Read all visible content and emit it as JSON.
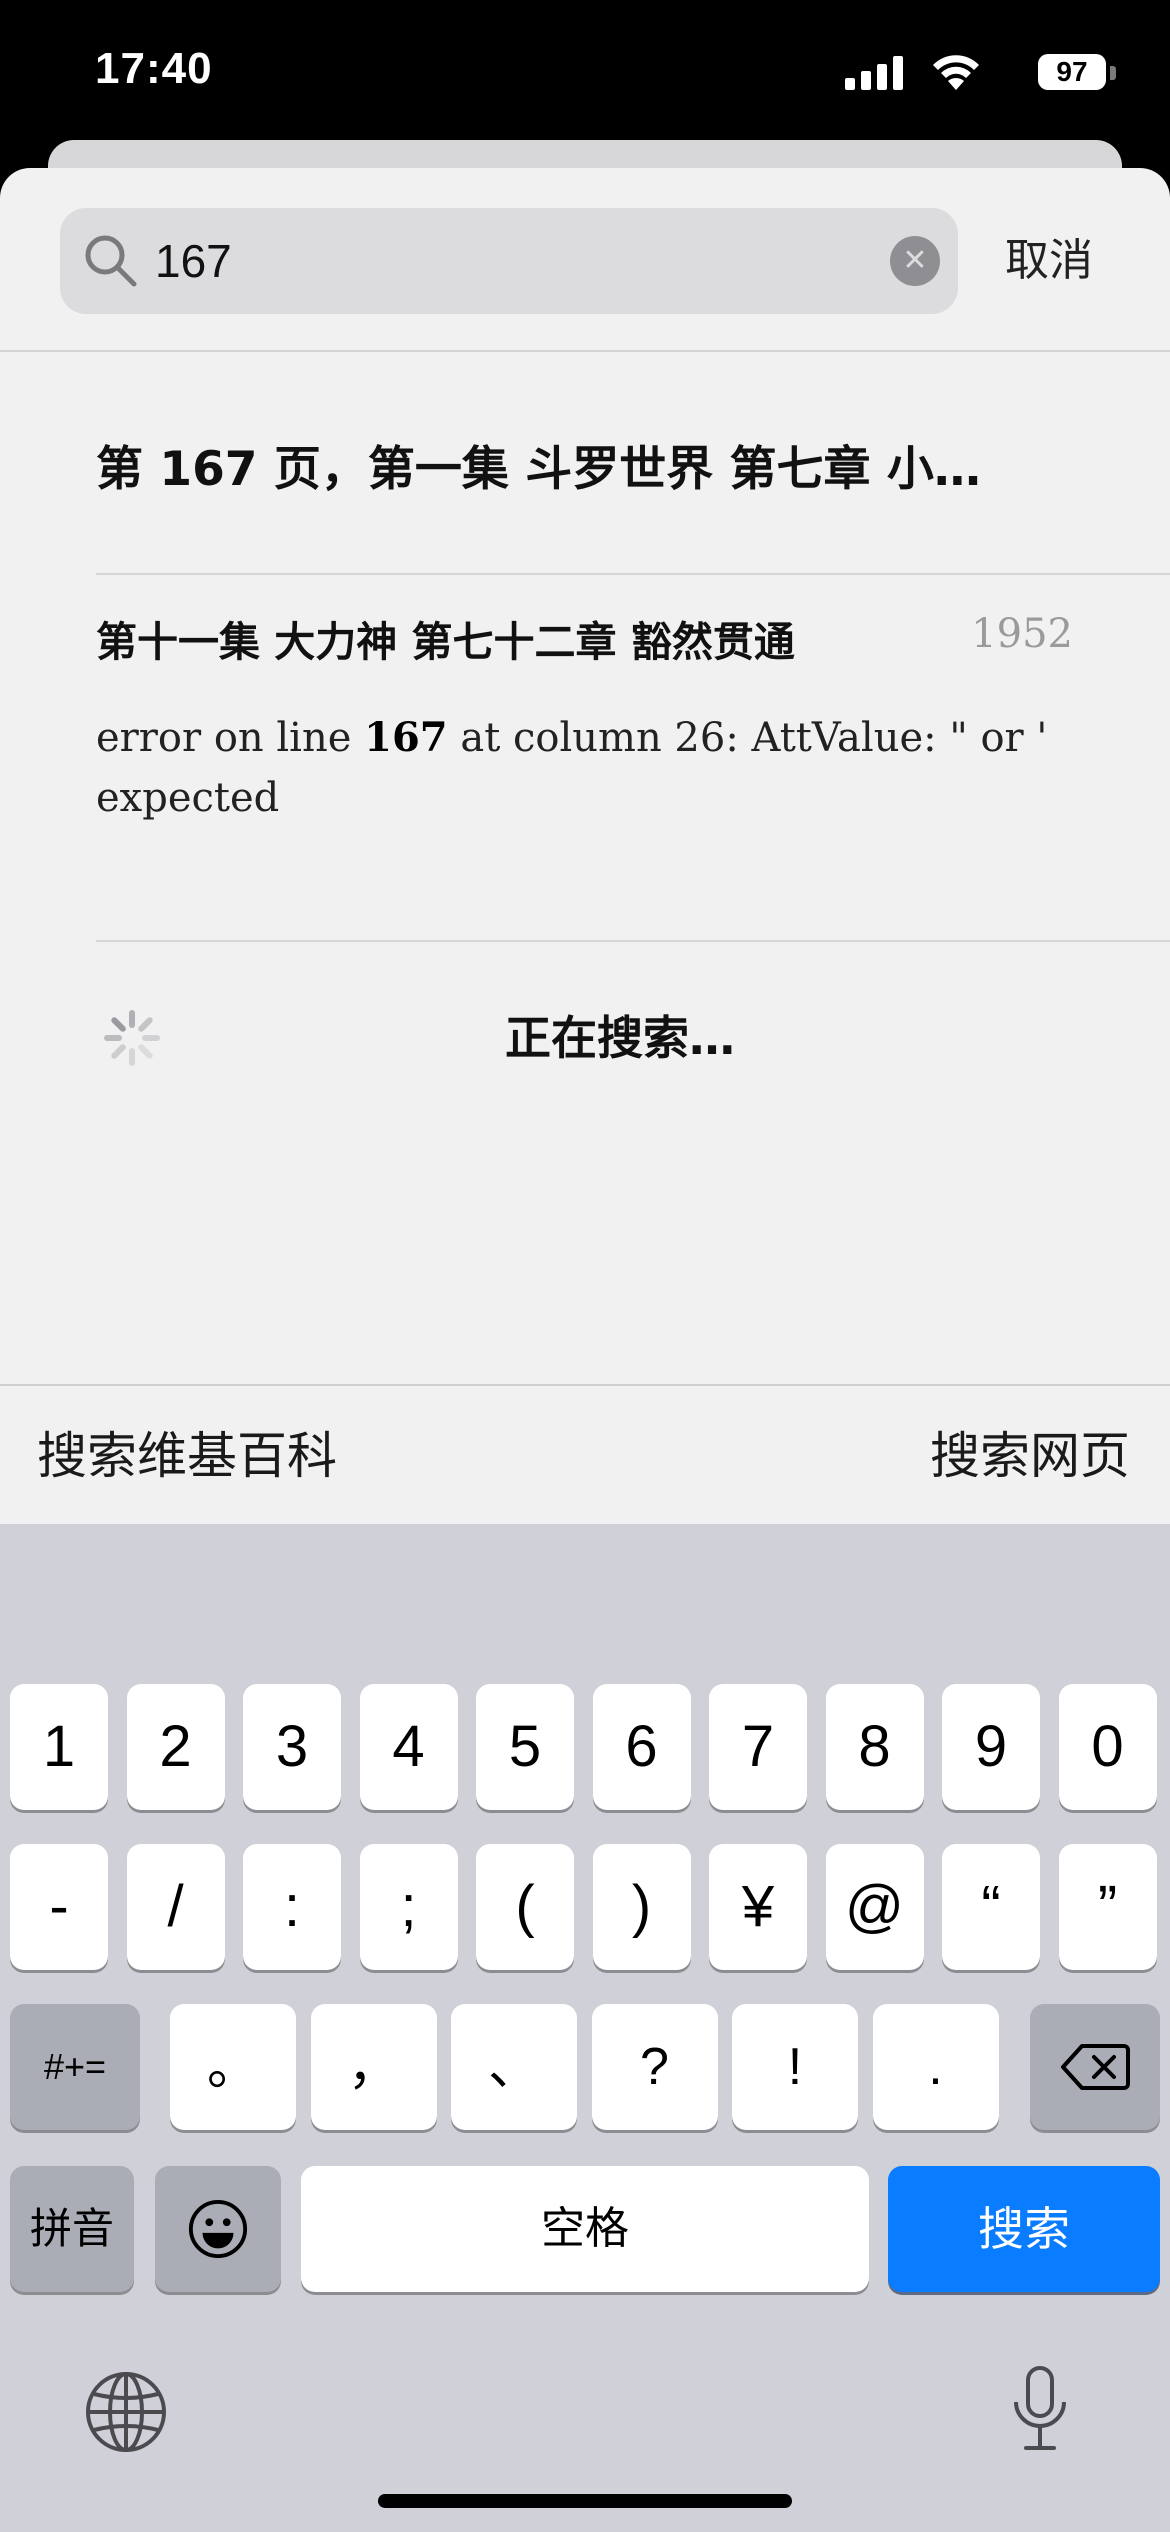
{
  "status": {
    "time": "17:40",
    "battery": "97"
  },
  "search": {
    "query": "167",
    "cancel_label": "取消"
  },
  "results": [
    {
      "title": "第 167 页，第一集 斗罗世界 第七章 小…"
    },
    {
      "title": "第十一集 大力神 第七十二章 豁然贯通",
      "page": "1952",
      "snippet_pre": "error on line ",
      "snippet_match": "167",
      "snippet_post": " at column 26: AttValue: \" or ' expected"
    }
  ],
  "searching_label": "正在搜索…",
  "links": {
    "wiki": "搜索维基百科",
    "web": "搜索网页"
  },
  "keyboard": {
    "row1": [
      "1",
      "2",
      "3",
      "4",
      "5",
      "6",
      "7",
      "8",
      "9",
      "0"
    ],
    "row2": [
      "-",
      "/",
      ":",
      ";",
      "(",
      ")",
      "¥",
      "@",
      "“",
      "”"
    ],
    "row3": [
      "。",
      "，",
      "、",
      "?",
      "!",
      "."
    ],
    "symbols_label": "#+=",
    "pinyin_label": "拼音",
    "space_label": "空格",
    "search_label": "搜索"
  },
  "colors": {
    "accent": "#0a7cff",
    "keyboard_bg": "#d0d1d8",
    "sheet_bg": "#f1f1f2"
  }
}
